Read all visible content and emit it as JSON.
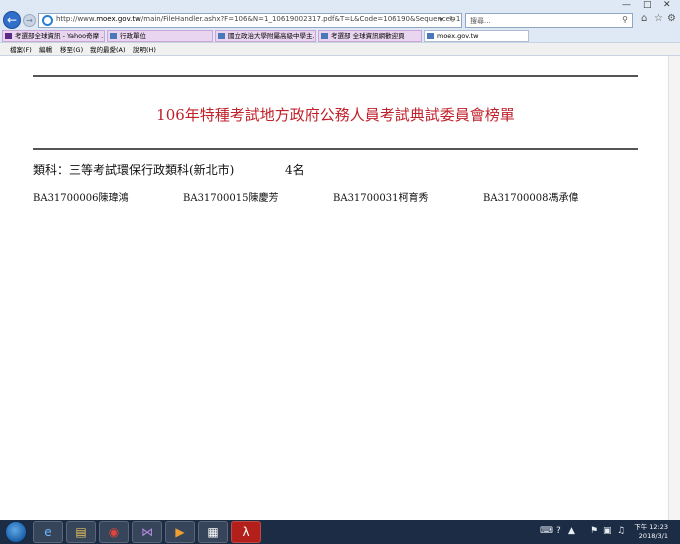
{
  "browser": {
    "address_url_prefix": "http://www.",
    "address_url_host": "moex.gov.tw",
    "address_url_rest": "/main/FileHandler.ashx?F=106&N=1_10619002317.pdf&T=L&Code=106190&Sequence=1",
    "search_placeholder": "搜尋...",
    "tabs": [
      {
        "label": "考選部全球資訊 - Yahoo奇摩 ...",
        "icon": "yahoo-icon"
      },
      {
        "label": "行政單位",
        "icon": "page-icon"
      },
      {
        "label": "國立政治大學附屬高級中學主...",
        "icon": "page-icon"
      },
      {
        "label": "考選部 全球資訊網歡迎頁",
        "icon": "page-icon"
      },
      {
        "label": "moex.gov.tw",
        "icon": "page-icon"
      }
    ],
    "menu": [
      "檔案(F)",
      "編輯",
      "移至(G)",
      "我的最愛(A)",
      "說明(H)"
    ]
  },
  "document": {
    "title": "106年特種考試地方政府公務人員考試典試委員會榜單",
    "category_label": "類科：三等考試環保行政類科(新北市)",
    "count": "4名",
    "names": [
      "BA31700006陳瑋鴻",
      "BA31700015陳慶芳",
      "BA31700031柯育秀",
      "BA31700008馮承偉"
    ]
  },
  "taskbar": {
    "time": "下午 12:23",
    "date": "2018/3/1"
  },
  "colors": {
    "title_red": "#c0202a",
    "tab_bg": "#ead5f0",
    "taskbar_bg": "#1b2c44"
  }
}
